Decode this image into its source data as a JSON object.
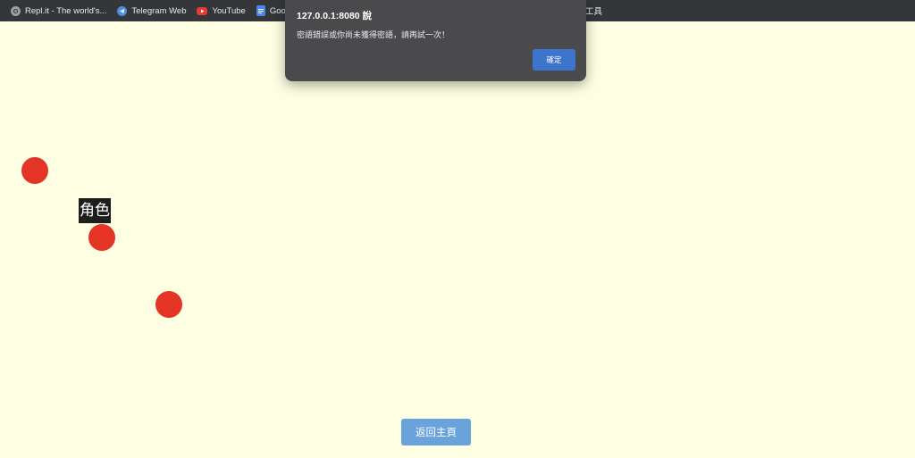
{
  "bookmarks": [
    {
      "label": "Repl.it - The world's...",
      "icon": "replit-icon"
    },
    {
      "label": "Telegram Web",
      "icon": "telegram-icon"
    },
    {
      "label": "YouTube",
      "icon": "youtube-icon"
    },
    {
      "label": "Googl",
      "icon": "google-docs-icon"
    }
  ],
  "bookmarks_right_label": "工具",
  "alert": {
    "title": "127.0.0.1:8080 說",
    "message": "密語錯誤或你尚未獲得密語，請再試一次！",
    "ok_label": "確定"
  },
  "canvas": {
    "dot_color": "#e33425",
    "role_label": "角色"
  },
  "home_button_label": "返回主頁",
  "colors": {
    "background": "#fefee3",
    "bookmarks_bar": "#35363a",
    "alert_bg": "#4a4a4c",
    "alert_button": "#3e75cc",
    "home_button": "#6aa3dc"
  }
}
